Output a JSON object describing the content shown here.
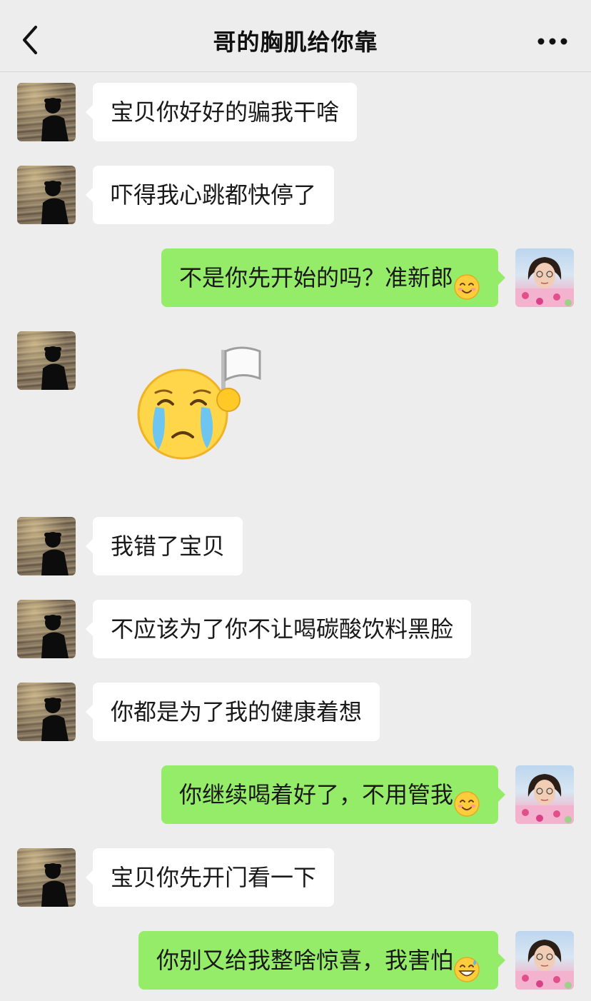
{
  "header": {
    "title": "哥的胸肌给你靠"
  },
  "messages": [
    {
      "side": "left",
      "text": "宝贝你好好的骗我干啥"
    },
    {
      "side": "left",
      "text": "吓得我心跳都快停了"
    },
    {
      "side": "right",
      "text": "不是你先开始的吗？准新郎",
      "emoji": "smiling-face-emoji"
    },
    {
      "side": "left",
      "sticker": "crying-face-white-flag-sticker"
    },
    {
      "side": "left",
      "text": "我错了宝贝"
    },
    {
      "side": "left",
      "text": "不应该为了你不让喝碳酸饮料黑脸"
    },
    {
      "side": "left",
      "text": "你都是为了我的健康着想"
    },
    {
      "side": "right",
      "text": "你继续喝着好了，不用管我",
      "emoji": "smiling-face-emoji"
    },
    {
      "side": "left",
      "text": "宝贝你先开门看一下"
    },
    {
      "side": "right",
      "text": "你别又给我整啥惊喜，我害怕",
      "emoji": "grinning-sweat-emoji"
    }
  ],
  "colors": {
    "background": "#ededed",
    "outgoing_bubble": "#95ec69",
    "incoming_bubble": "#ffffff"
  },
  "icons": {
    "back": "chevron-left-icon",
    "more": "more-dots-icon"
  }
}
